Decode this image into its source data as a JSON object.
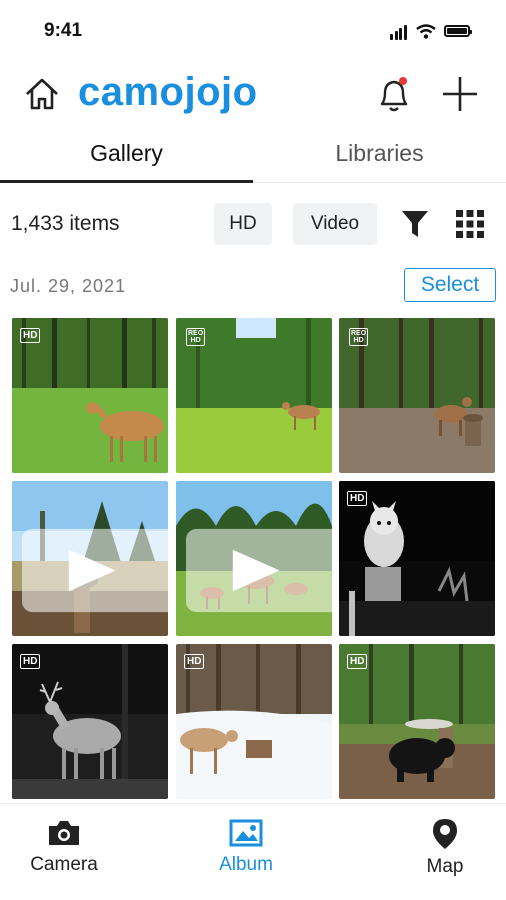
{
  "status_bar": {
    "time": "9:41"
  },
  "header": {
    "logo": "camojojo",
    "accent": "#1a8fe0",
    "notification_dot": "#e53935"
  },
  "tabs": [
    {
      "label": "Gallery",
      "active": true
    },
    {
      "label": "Libraries",
      "active": false
    }
  ],
  "toolbar": {
    "item_count": "1,433 items",
    "hd_chip": "HD",
    "video_chip": "Video"
  },
  "date_group": {
    "date": "Jul. 29,  2021",
    "select_label": "Select"
  },
  "photos": [
    {
      "badge": "HD",
      "subject": "deer-in-forest"
    },
    {
      "badge": "REO HD",
      "subject": "deer-in-meadow"
    },
    {
      "badge": "REO HD",
      "subject": "deer-at-feeder"
    },
    {
      "badge": "video",
      "subject": "duck-at-pond"
    },
    {
      "badge": "video",
      "subject": "deer-family-field"
    },
    {
      "badge": "HD",
      "subject": "raccoon-night"
    },
    {
      "badge": "HD",
      "subject": "buck-night"
    },
    {
      "badge": "HD",
      "subject": "deer-in-snow"
    },
    {
      "badge": "HD",
      "subject": "bear-at-feeder"
    }
  ],
  "bottom_nav": [
    {
      "label": "Camera",
      "icon": "camera-icon"
    },
    {
      "label": "Album",
      "icon": "image-icon",
      "active": true
    },
    {
      "label": "Map",
      "icon": "map-pin-icon"
    }
  ]
}
